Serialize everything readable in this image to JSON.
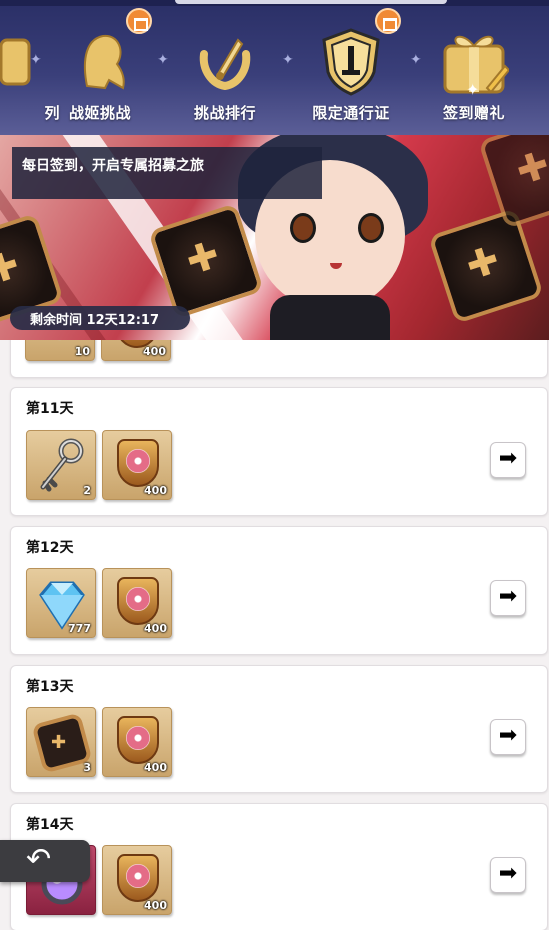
{
  "nav": {
    "items": [
      {
        "label": "列",
        "icon": "scroll-icon"
      },
      {
        "label": "战姬挑战",
        "icon": "maiden-silhouette-icon",
        "badge": true
      },
      {
        "label": "挑战排行",
        "icon": "laurel-sword-icon"
      },
      {
        "label": "限定通行证",
        "icon": "shield-sword-icon",
        "badge": true
      },
      {
        "label": "签到赠礼",
        "icon": "gift-box-icon"
      }
    ]
  },
  "banner": {
    "title": "每日签到，开启专属招募之旅",
    "timer": "剩余时间 12天12:17"
  },
  "days": [
    {
      "title": "",
      "rewards": [
        {
          "icon": "dice-icon",
          "count": "10"
        },
        {
          "icon": "shield-badge-icon",
          "count": "400"
        }
      ]
    },
    {
      "title": "第11天",
      "rewards": [
        {
          "icon": "key-icon",
          "count": "2"
        },
        {
          "icon": "shield-badge-icon",
          "count": "400"
        }
      ]
    },
    {
      "title": "第12天",
      "rewards": [
        {
          "icon": "diamond-icon",
          "count": "777"
        },
        {
          "icon": "shield-badge-icon",
          "count": "400"
        }
      ]
    },
    {
      "title": "第13天",
      "rewards": [
        {
          "icon": "dice-icon",
          "count": "3"
        },
        {
          "icon": "shield-badge-icon",
          "count": "400"
        }
      ]
    },
    {
      "title": "第14天",
      "rewards": [
        {
          "icon": "orb-icon",
          "count": ""
        },
        {
          "icon": "shield-badge-icon",
          "count": "400"
        }
      ]
    }
  ],
  "colors": {
    "nav_bg": "#2a2f66",
    "badge": "#f08a35",
    "banner_red": "#c23f4d"
  }
}
